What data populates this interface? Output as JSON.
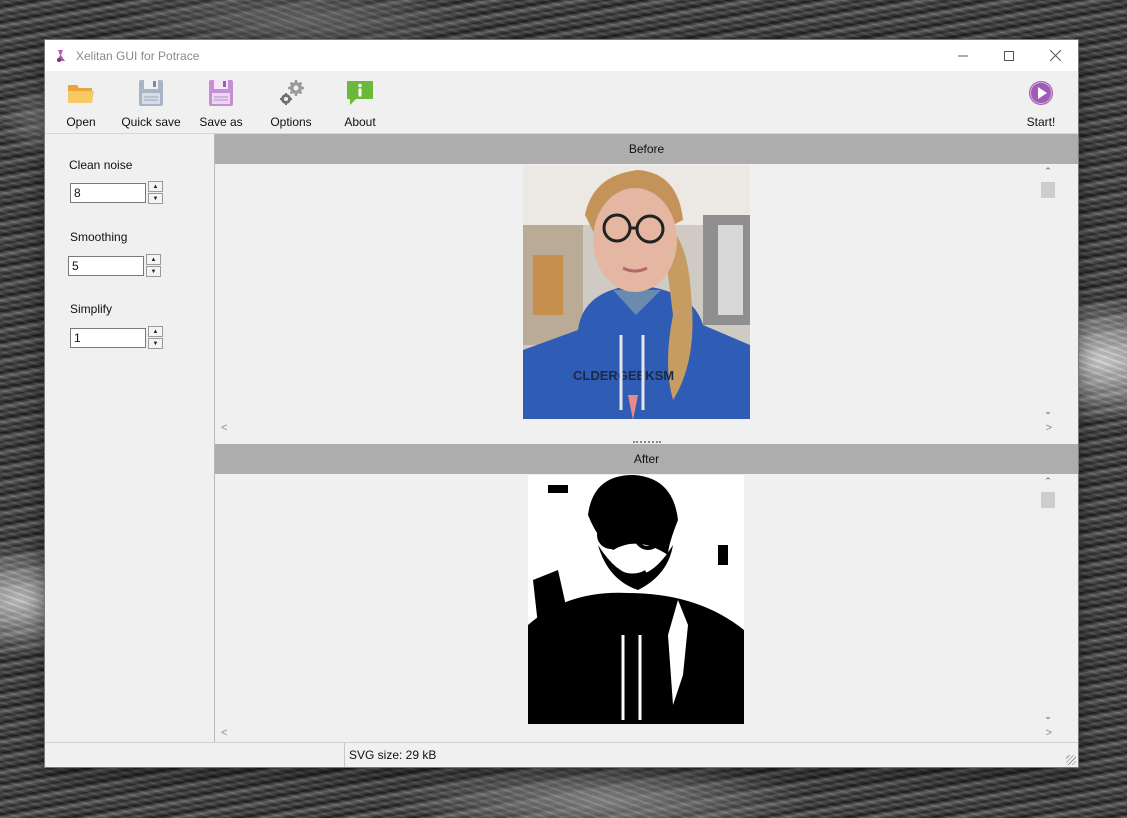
{
  "window": {
    "title": "Xelitan GUI for Potrace"
  },
  "toolbar": {
    "open": "Open",
    "quick_save": "Quick save",
    "save_as": "Save as",
    "options": "Options",
    "about": "About",
    "start": "Start!"
  },
  "params": {
    "clean_noise": {
      "label": "Clean noise",
      "value": "8"
    },
    "smoothing": {
      "label": "Smoothing",
      "value": "5"
    },
    "simplify": {
      "label": "Simplify",
      "value": "1"
    }
  },
  "panes": {
    "before": "Before",
    "after": "After"
  },
  "statusbar": {
    "svg_size": "SVG size: 29 kB"
  },
  "icons": {
    "open": "folder-icon",
    "quick_save": "floppy-disk-icon",
    "save_as": "floppy-disk-purple-icon",
    "options": "gears-icon",
    "about": "info-bubble-icon",
    "start": "play-circle-icon"
  },
  "colors": {
    "pane_header": "#adadad",
    "start_icon": "#a05cb4",
    "about_icon": "#6ab93b",
    "folder_icon": "#f2b84b"
  }
}
